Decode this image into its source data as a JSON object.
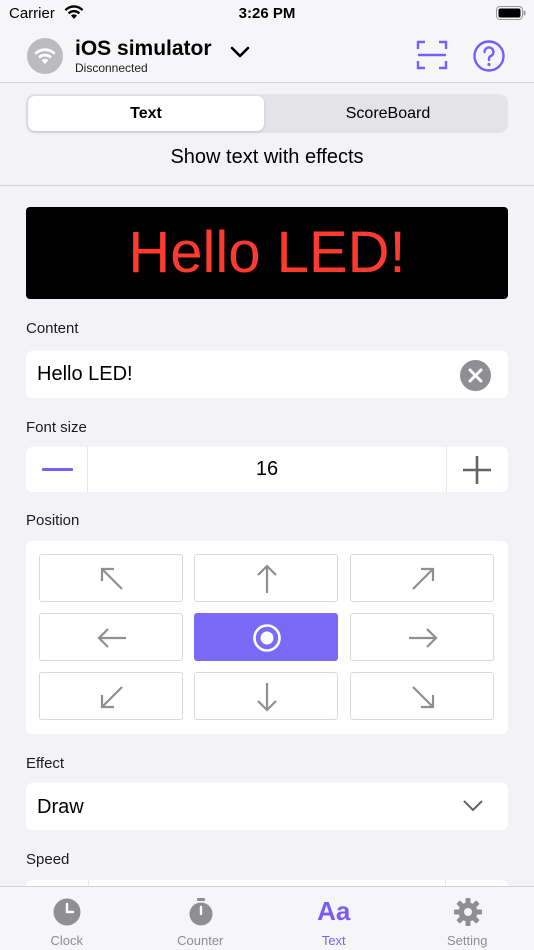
{
  "status_bar": {
    "carrier": "Carrier",
    "time": "3:26 PM"
  },
  "header": {
    "device_name": "iOS simulator",
    "device_status": "Disconnected",
    "icons": [
      "wifi-icon",
      "chevron-down-icon",
      "scan-icon",
      "help-icon"
    ]
  },
  "segments": {
    "selected": "Text",
    "other": "ScoreBoard"
  },
  "subtitle": "Show text with effects",
  "preview": {
    "text": "Hello LED!",
    "color": "#ff3b30"
  },
  "content": {
    "label": "Content",
    "value": "Hello LED!"
  },
  "font_size": {
    "label": "Font size",
    "value": "16"
  },
  "position": {
    "label": "Position",
    "selected": "center",
    "cells": [
      "top-left",
      "top",
      "top-right",
      "left",
      "center",
      "right",
      "bottom-left",
      "bottom",
      "bottom-right"
    ]
  },
  "effect": {
    "label": "Effect",
    "value": "Draw"
  },
  "speed": {
    "label": "Speed"
  },
  "tabs": [
    {
      "label": "Clock",
      "icon": "clock-icon"
    },
    {
      "label": "Counter",
      "icon": "stopwatch-icon"
    },
    {
      "label": "Text",
      "icon": "text-aa-icon"
    },
    {
      "label": "Setting",
      "icon": "gear-icon"
    }
  ],
  "colors": {
    "accent": "#7a5cfa",
    "led": "#ff3b30"
  }
}
